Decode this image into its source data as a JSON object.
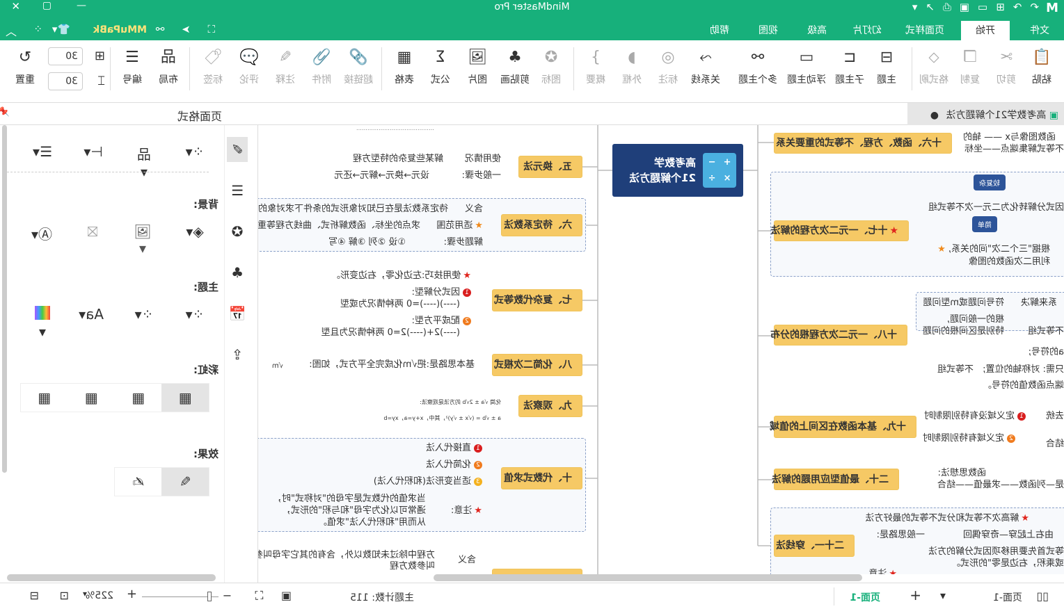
{
  "app": {
    "title": "MindMaster Pro",
    "user": "MMuPaBk",
    "brand_color": "#17b07b"
  },
  "menu": {
    "tabs": [
      "文件",
      "开始",
      "页面样式",
      "幻灯片",
      "高级",
      "视图",
      "帮助"
    ],
    "active": "开始"
  },
  "ribbon": {
    "items": [
      "粘贴",
      "剪切",
      "复制",
      "格式刷",
      "主题",
      "子主题",
      "浮动主题",
      "多个主题",
      "关系线",
      "标注",
      "外框",
      "概要",
      "图标",
      "剪贴画",
      "图片",
      "公式",
      "表格",
      "超链接",
      "附件",
      "注释",
      "评论",
      "标签",
      "布局",
      "编号",
      "重置"
    ],
    "spacing_h": "30",
    "spacing_v": "30"
  },
  "doc_tab": "高考数学21个解题方法",
  "panel": {
    "title": "页面格式",
    "background": "背景:",
    "theme": "主题:",
    "rainbow": "彩虹:",
    "effect": "效果:"
  },
  "map": {
    "central": "高考数学\n21个解题方法",
    "t5": {
      "title": "五、换元法",
      "c1": "使用情况",
      "c1v": "解某些复杂的特型方程",
      "c2": "一般步骤:",
      "c2v": "设元→换元→解元→还元"
    },
    "t6": {
      "title": "六、待定系数法",
      "c1": "含义",
      "c1v": "待定系数法是在已知对象形式的条件下求对象的",
      "c2": "适用范围",
      "c2v": "求点的坐标、函数解析式、曲线方程等重",
      "c3": "解题步骤:",
      "c3v": "①设 ②列 ③解 ④写"
    },
    "t7": {
      "title": "七、复杂代数等式",
      "c1": "使用技巧:左边化零，右边变形。",
      "c2a": "因式分解型:",
      "c2b": "(----)(----)=0 两种情况为或型",
      "c3a": "配成平方型:",
      "c3b": "(----)2+(----)2=0 两种情况为且型"
    },
    "t8": {
      "title": "八、化简二次根式",
      "c1": "基本思路是:把√m化成完全平方式，如图:",
      "c2": "√m"
    },
    "t9": {
      "title": "九、观察法",
      "c1": "化简 √a ± 2√b 的方法是观察法:",
      "c2": "a ± √b = (√x ± √y)²，其中，x+y=a，xy=b"
    },
    "t10": {
      "title": "十、代数式求值",
      "c1": "直接代入法",
      "c2": "化简代入法",
      "c3": "适当变形法(和积代入法)",
      "c4": "注意:",
      "c4v": [
        "当求值的代数式是字母的\"对称式\"时，",
        "通常可以化为字母\"和与积\"的形式，",
        "从而用\"和积代入法\"求值。"
      ]
    },
    "t11": {
      "c1": "含义",
      "c1v": [
        "方程中除过未知数以外，含有的其它字母叫参",
        "叫参数方程"
      ]
    },
    "t16": {
      "title": "十六、函数、方程、不等式的重要关系",
      "c1": "函数图像与x —— 轴的",
      "c2": "不等式解集端点——坐标"
    },
    "t17": {
      "title": "十七、一元二次方程的解法",
      "c1": "因式分解转化为二元一次不等式组",
      "c1note": "较复杂",
      "c2": [
        "根据\"三个二次\"间的关系,",
        "利用二次函数的图像"
      ],
      "c2note": "简单"
    },
    "t18": {
      "title": "十八、一元二次方程根的分布",
      "c1": "符号问题或m型问题",
      "c1v": "系来解决",
      "c2": [
        "根的一般问题,",
        "特别是区间根的问题"
      ],
      "c2v": "不等式组",
      "c3": "不等式组",
      "c3a": "a的符号;",
      "c3b": "只需: 对称轴的位置;",
      "c3c": "端点函数值的符号。"
    },
    "t19": {
      "title": "十九、基本函数在区间上的值域",
      "c1": "定义域没有特别限制时",
      "c1v": "去统",
      "c2": "定义域有特别限制时",
      "c2v": "结合"
    },
    "t20": {
      "title": "二十、最值型应用题的解法",
      "c1": "函数思想法:",
      "c2": "是—列函数——求最值——结合"
    },
    "t21": {
      "title": "二十一、穿线法",
      "c1": "解高次不等式和分式不等式的最好方法",
      "c2": "一般思路是:",
      "c2v": "由右上起穿—奇穿偶回",
      "c3": [
        "等式首先要用移项因式分解的方法",
        "或乘积，右边是零\"的形式。"
      ],
      "c4": "注意"
    }
  },
  "status": {
    "page_tab": "页面-1",
    "page_tab_active": "页面-1",
    "topic_count": "主题计数: 115",
    "zoom": "225%"
  }
}
